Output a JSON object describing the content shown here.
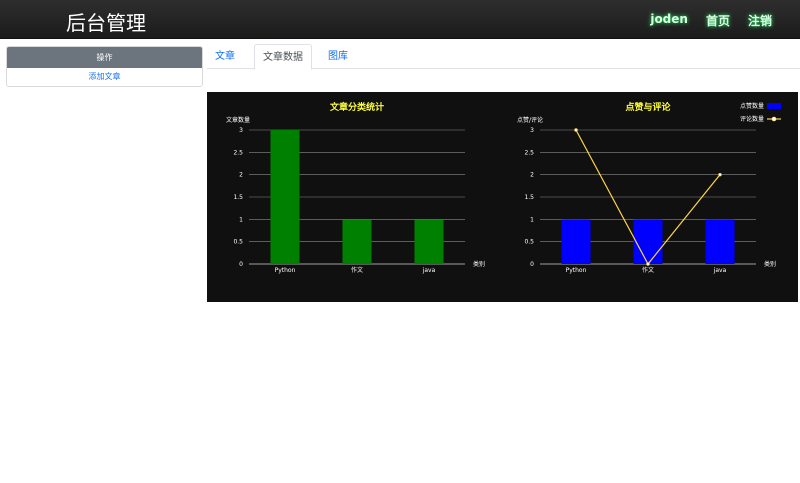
{
  "header": {
    "title": "后台管理",
    "nav": [
      "joden",
      "首页",
      "注销"
    ]
  },
  "sidebar": {
    "heading": "操作",
    "items": [
      {
        "label": "添加文章"
      }
    ]
  },
  "tabs": [
    {
      "label": "文章"
    },
    {
      "label": "文章数据"
    },
    {
      "label": "图库"
    }
  ],
  "colors": {
    "bar_left": "#008000",
    "bar_right": "#0000ff",
    "line": "#ffd54a",
    "title": "#ffff3b",
    "bg": "#101010"
  },
  "chart_data": [
    {
      "type": "bar",
      "title": "文章分类统计",
      "ylabel": "文章数量",
      "xlabel": "类别",
      "categories": [
        "Python",
        "作文",
        "java"
      ],
      "series": [
        {
          "values": [
            3,
            1,
            1
          ]
        }
      ],
      "yticks": [
        "0",
        "0.5",
        "1",
        "1.5",
        "2",
        "2.5",
        "3"
      ],
      "ylim": [
        0,
        3
      ],
      "grid": true
    },
    {
      "type": "bar",
      "title": "点赞与评论",
      "ylabel": "点赞/评论",
      "xlabel": "类别",
      "categories": [
        "Python",
        "作文",
        "java"
      ],
      "series": [
        {
          "name": "点赞数量",
          "type": "bar",
          "values": [
            1,
            1,
            1
          ]
        },
        {
          "name": "评论数量",
          "type": "line",
          "values": [
            3,
            0,
            2
          ]
        }
      ],
      "yticks": [
        "0",
        "0.5",
        "1",
        "1.5",
        "2",
        "2.5",
        "3"
      ],
      "ylim": [
        0,
        3
      ],
      "grid": true,
      "legend": "top-right"
    }
  ]
}
